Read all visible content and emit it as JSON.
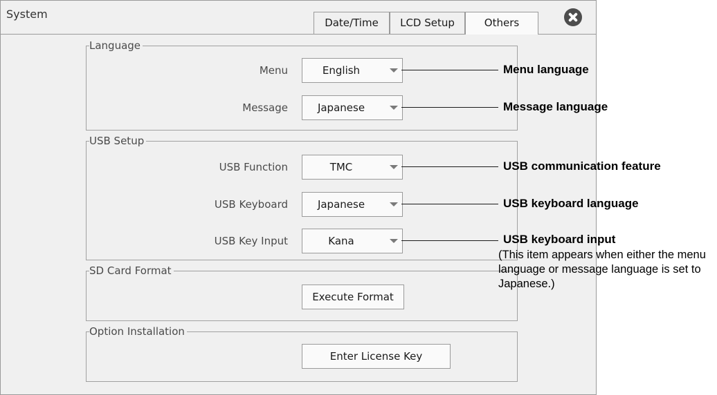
{
  "window": {
    "title": "System",
    "tabs": [
      {
        "label": "Date/Time"
      },
      {
        "label": "LCD Setup"
      },
      {
        "label": "Others"
      }
    ]
  },
  "language": {
    "group_label": "Language",
    "menu_label": "Menu",
    "menu_value": "English",
    "message_label": "Message",
    "message_value": "Japanese"
  },
  "usb_setup": {
    "group_label": "USB Setup",
    "function_label": "USB Function",
    "function_value": "TMC",
    "keyboard_label": "USB Keyboard",
    "keyboard_value": "Japanese",
    "key_input_label": "USB Key Input",
    "key_input_value": "Kana"
  },
  "sd_card": {
    "group_label": "SD Card Format",
    "execute_label": "Execute Format"
  },
  "option_installation": {
    "group_label": "Option Installation",
    "license_label": "Enter License Key"
  },
  "callouts": {
    "menu_language": "Menu language",
    "message_language": "Message language",
    "usb_communication": "USB communication feature",
    "usb_keyboard_language": "USB keyboard language",
    "usb_keyboard_input": "USB keyboard input",
    "usb_keyboard_input_note": "(This item appears when either the menu language or message language is set to Japanese.)"
  }
}
